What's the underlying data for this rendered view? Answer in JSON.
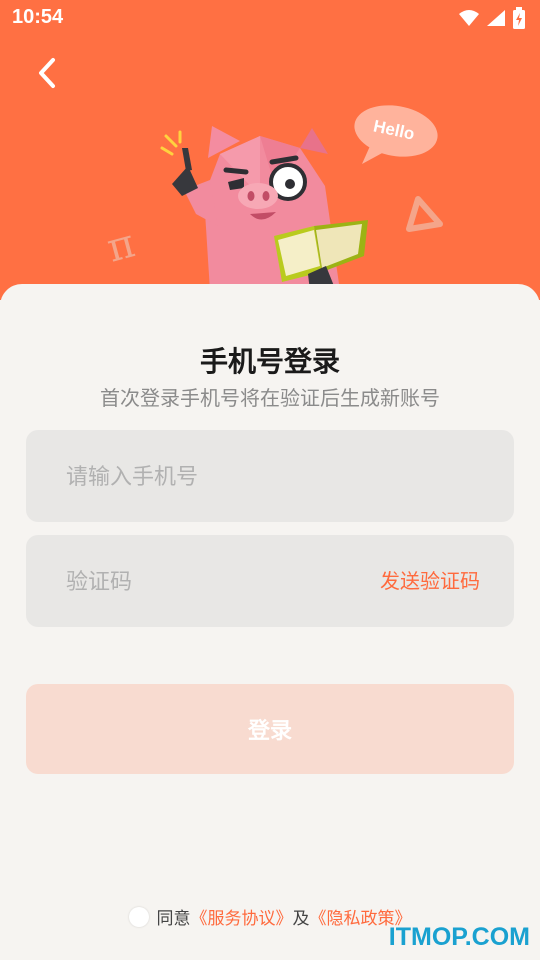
{
  "status_bar": {
    "time": "10:54"
  },
  "illustration": {
    "bubble_text": "Hello",
    "pi_symbol": "π"
  },
  "login": {
    "title": "手机号登录",
    "subtitle": "首次登录手机号将在验证后生成新账号",
    "phone_placeholder": "请输入手机号",
    "code_placeholder": "验证码",
    "send_code_label": "发送验证码",
    "login_button_label": "登录"
  },
  "agreement": {
    "prefix": "同意",
    "service_link": "《服务协议》",
    "connector": "及",
    "privacy_link": "《隐私政策》"
  },
  "watermark": "ITMOP.COM",
  "colors": {
    "header": "#ff7043",
    "accent": "#ff6a3d",
    "background": "#f6f4f1",
    "field": "#e8e7e5",
    "button_disabled": "#f8dbd0"
  },
  "icons": [
    "back-arrow-icon",
    "wifi-icon",
    "signal-icon",
    "battery-icon",
    "radio-unchecked-icon"
  ]
}
